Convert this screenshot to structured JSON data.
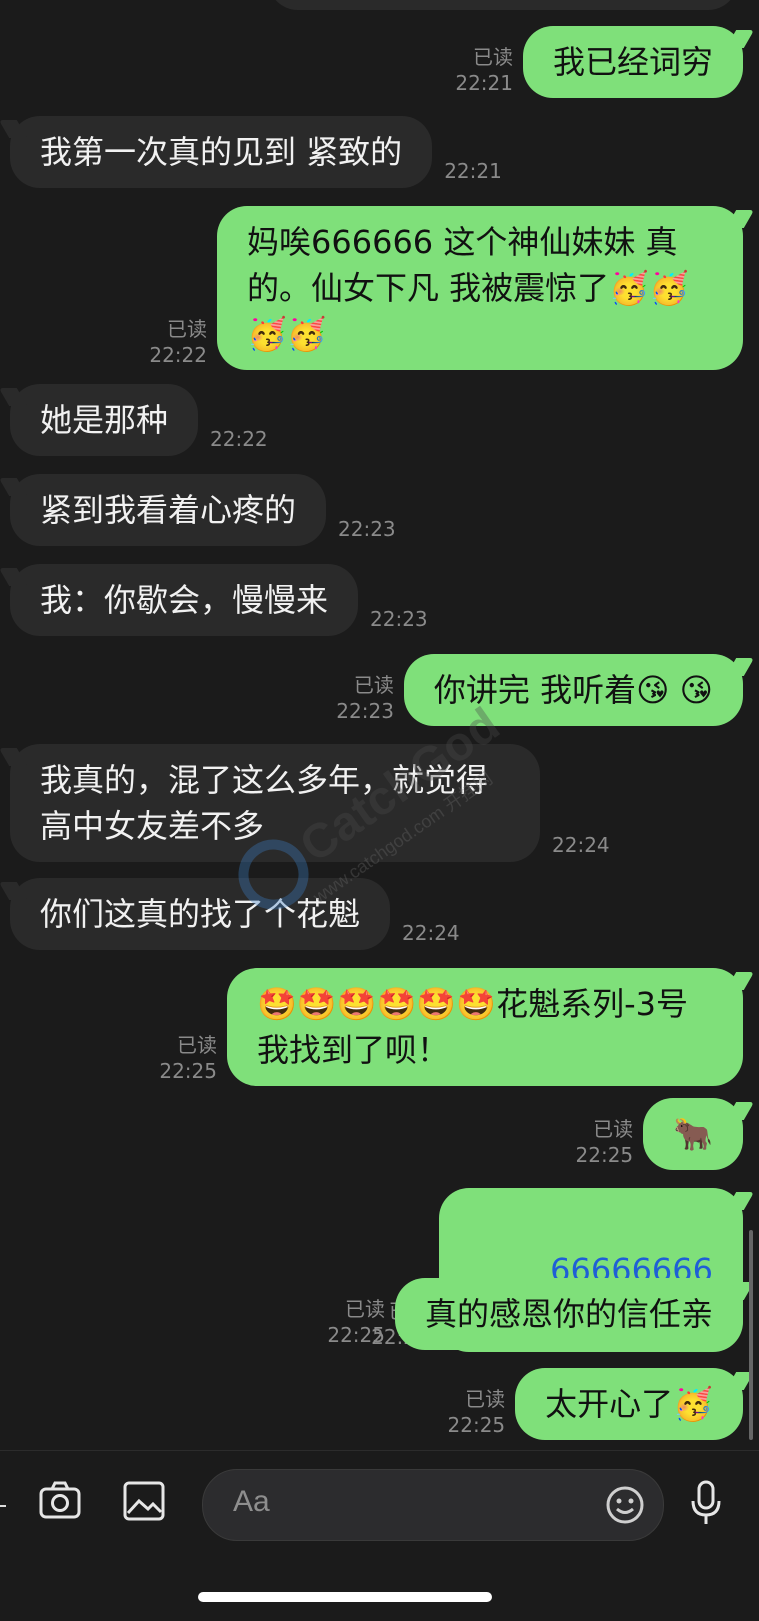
{
  "messages": [
    {
      "dir": "out",
      "text": "我已经词穷",
      "read": "已读",
      "time": "22:21"
    },
    {
      "dir": "in",
      "text": "我第一次真的见到 紧致的",
      "time": "22:21"
    },
    {
      "dir": "out",
      "text": "妈唉666666 这个神仙妹妹 真的。仙女下凡 我被震惊了🥳🥳🥳🥳",
      "read": "已读",
      "time": "22:22"
    },
    {
      "dir": "in",
      "text": "她是那种",
      "time": "22:22"
    },
    {
      "dir": "in",
      "text": "紧到我看着心疼的",
      "time": "22:23"
    },
    {
      "dir": "in",
      "text": "我：你歇会，慢慢来",
      "time": "22:23"
    },
    {
      "dir": "out",
      "text": "你讲完 我听着😘 😘",
      "read": "已读",
      "time": "22:23"
    },
    {
      "dir": "in",
      "text": "我真的，混了这么多年，就觉得高中女友差不多",
      "time": "22:24"
    },
    {
      "dir": "in",
      "text": "你们这真的找了个花魁",
      "time": "22:24"
    },
    {
      "dir": "out",
      "text": "🤩🤩🤩🤩🤩🤩花魁系列-3号 我找到了呗！",
      "read": "已读",
      "time": "22:25"
    },
    {
      "dir": "out",
      "text": "🐂",
      "read": "已读",
      "time": "22:25"
    },
    {
      "dir": "out",
      "text": "66666666",
      "link": true,
      "read": "已读",
      "time": "22:25"
    },
    {
      "dir": "out",
      "text": "真的感恩你的信任亲",
      "read": "已读",
      "time": "22:25"
    },
    {
      "dir": "out",
      "text": "太开心了🥳",
      "read": "已读",
      "time": "22:25"
    }
  ],
  "composer": {
    "placeholder": "Aa",
    "icons": {
      "camera": "camera-icon",
      "gallery": "image-icon",
      "emoji": "smiley-icon",
      "mic": "microphone-icon"
    }
  },
  "watermark": {
    "text": "www.catchgod.com 开挂网",
    "brand": "CatchGod"
  },
  "colors": {
    "bg": "#1b1b1b",
    "incoming": "#2a2a2a",
    "outgoing": "#7fe07a",
    "meta": "#8a8a8a",
    "link": "#1f5fd6"
  }
}
